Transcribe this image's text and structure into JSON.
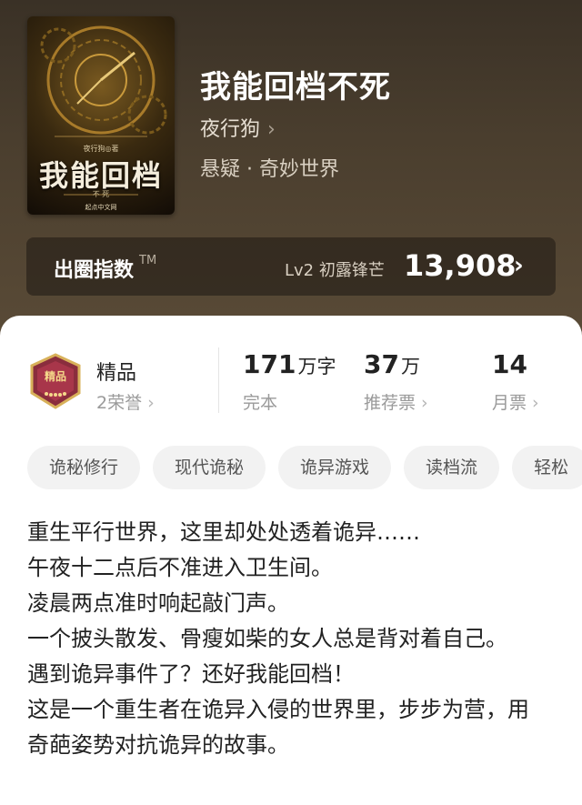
{
  "book": {
    "title": "我能回档不死",
    "author": "夜行狗",
    "genre": "悬疑 · 奇妙世界",
    "cover": {
      "title": "我能回档",
      "author_line": "夜行狗◎著",
      "subtitle": "不 死",
      "publisher": "起点中文网"
    }
  },
  "popularity": {
    "label": "出圈指数",
    "tm": "TM",
    "level": "Lv2 初露锋芒",
    "value": "13,908"
  },
  "quality": {
    "badge_text": "精品",
    "title": "精品",
    "honors": "2荣誉"
  },
  "stats": [
    {
      "number": "171",
      "unit": "万字",
      "label": "完本"
    },
    {
      "number": "37",
      "unit": "万",
      "label": "推荐票"
    },
    {
      "number": "14",
      "unit": "",
      "label": "月票"
    }
  ],
  "tags": [
    "诡秘修行",
    "现代诡秘",
    "诡异游戏",
    "读档流",
    "轻松"
  ],
  "description": [
    "重生平行世界，这里却处处透着诡异……",
    "午夜十二点后不准进入卫生间。",
    "凌晨两点准时响起敲门声。",
    "一个披头散发、骨瘦如柴的女人总是背对着自己。",
    "遇到诡异事件了？还好我能回档！",
    "这是一个重生者在诡异入侵的世界里，步步为营，用奇葩姿势对抗诡异的故事。"
  ],
  "colors": {
    "header_bg": "#4a3e2e",
    "badge": "#8a2d3d"
  },
  "icons": {
    "chevron": "chevron-right-icon",
    "popularity_arrow": "arrow-right-icon",
    "badge": "quality-badge-icon"
  }
}
